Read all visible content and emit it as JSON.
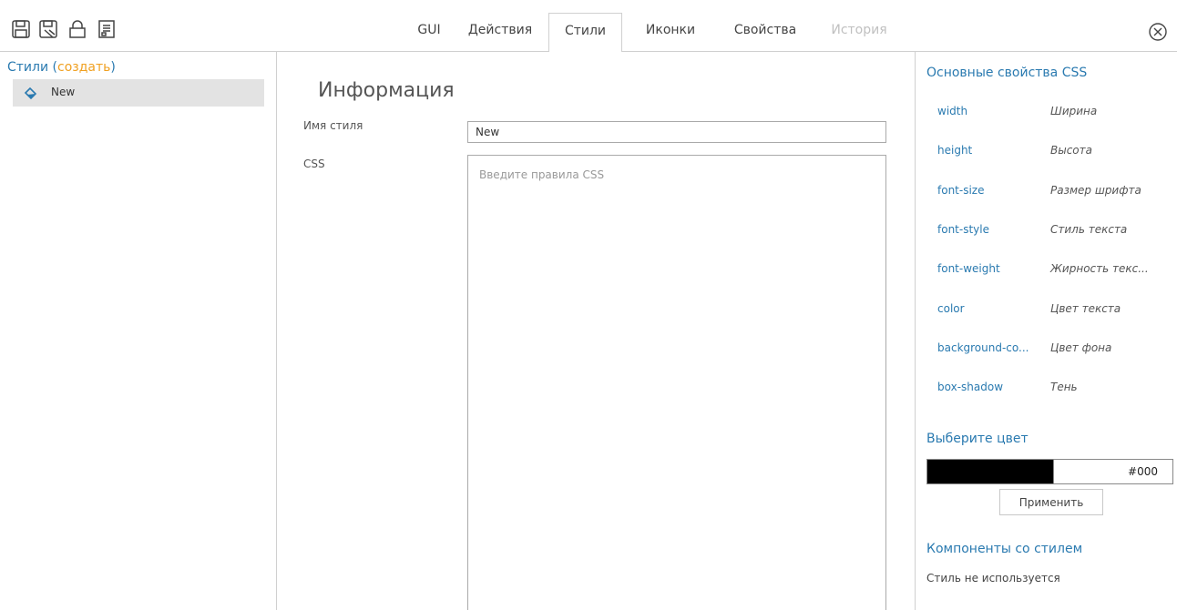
{
  "toolbar": {
    "icons": [
      "save-icon",
      "save-as-icon",
      "lock-icon",
      "properties-icon"
    ],
    "close_icon": "close-icon"
  },
  "tabs": [
    {
      "label": "GUI",
      "active": false,
      "disabled": false
    },
    {
      "label": "Действия",
      "active": false,
      "disabled": false
    },
    {
      "label": "Стили",
      "active": true,
      "disabled": false
    },
    {
      "label": "Иконки",
      "active": false,
      "disabled": false
    },
    {
      "label": "Свойства",
      "active": false,
      "disabled": false
    },
    {
      "label": "История",
      "active": false,
      "disabled": true
    }
  ],
  "sidebar": {
    "title": "Стили",
    "open_paren": "(",
    "create_link": "создать",
    "close_paren": ")",
    "items": [
      {
        "label": "New",
        "icon": "paint-bucket-icon"
      }
    ]
  },
  "main": {
    "section_title": "Информация",
    "name_label": "Имя стиля",
    "name_value": "New",
    "css_label": "CSS",
    "css_placeholder": "Введите правила CSS",
    "css_value": ""
  },
  "right_panel": {
    "css_props_title": "Основные свойства CSS",
    "css_props": [
      {
        "name": "width",
        "desc": "Ширина"
      },
      {
        "name": "height",
        "desc": "Высота"
      },
      {
        "name": "font-size",
        "desc": "Размер шрифта"
      },
      {
        "name": "font-style",
        "desc": "Стиль текста"
      },
      {
        "name": "font-weight",
        "desc": "Жирность текс..."
      },
      {
        "name": "color",
        "desc": "Цвет текста"
      },
      {
        "name": "background-co...",
        "desc": "Цвет фона"
      },
      {
        "name": "box-shadow",
        "desc": "Тень"
      }
    ],
    "color_title": "Выберите цвет",
    "color_value": "#000",
    "apply_label": "Применить",
    "components_title": "Компоненты со стилем",
    "components_empty": "Стиль не используется"
  },
  "colors": {
    "accent": "#2a7ab0",
    "link_orange": "#f0a020",
    "selected_bg": "#e3e3e3",
    "swatch": "#000000"
  }
}
